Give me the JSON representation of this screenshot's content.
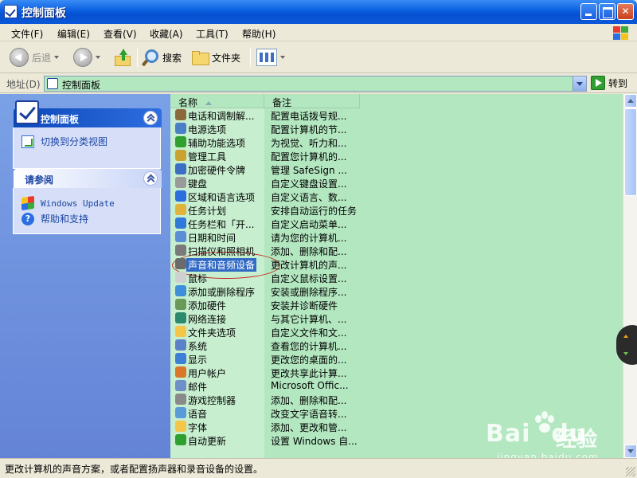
{
  "window": {
    "title": "控制面板"
  },
  "menu": [
    "文件(F)",
    "编辑(E)",
    "查看(V)",
    "收藏(A)",
    "工具(T)",
    "帮助(H)"
  ],
  "toolbar": {
    "back": "后退",
    "search": "搜索",
    "folders": "文件夹"
  },
  "address": {
    "label": "地址(D)",
    "value": "控制面板",
    "go": "转到"
  },
  "left_panel": {
    "main": {
      "title": "控制面板",
      "task": "切换到分类视图"
    },
    "see_also": {
      "title": "请参阅",
      "links": [
        "Windows Update",
        "帮助和支持"
      ]
    }
  },
  "list": {
    "columns": [
      "名称",
      "备注"
    ],
    "selected_index": 11,
    "items": [
      {
        "name": "电话和调制解...",
        "note": "配置电话拨号规...",
        "icon_color": "#8a6a3c"
      },
      {
        "name": "电源选项",
        "note": "配置计算机的节...",
        "icon_color": "#4a7fc7"
      },
      {
        "name": "辅助功能选项",
        "note": "为视觉、听力和...",
        "icon_color": "#2fa02f"
      },
      {
        "name": "管理工具",
        "note": "配置您计算机的...",
        "icon_color": "#c9a232"
      },
      {
        "name": "加密硬件令牌",
        "note": "管理 SafeSign ...",
        "icon_color": "#3c6fc4"
      },
      {
        "name": "键盘",
        "note": "自定义键盘设置...",
        "icon_color": "#9a9a9a"
      },
      {
        "name": "区域和语言选项",
        "note": "自定义语言、数...",
        "icon_color": "#2b6ee0"
      },
      {
        "name": "任务计划",
        "note": "安排自动运行的任务",
        "icon_color": "#e0b43a"
      },
      {
        "name": "任务栏和「开...",
        "note": "自定义启动菜单...",
        "icon_color": "#2f7ad8"
      },
      {
        "name": "日期和时间",
        "note": "请为您的计算机...",
        "icon_color": "#5a8fd8"
      },
      {
        "name": "扫描仪和照相机",
        "note": "添加、删除和配...",
        "icon_color": "#7a7a7a"
      },
      {
        "name": "声音和音频设备",
        "note": "更改计算机的声...",
        "icon_color": "#6b6b6b"
      },
      {
        "name": "鼠标",
        "note": "自定义鼠标设置...",
        "icon_color": "#d0d0d0"
      },
      {
        "name": "添加或删除程序",
        "note": "安装或删除程序...",
        "icon_color": "#3c8fd8"
      },
      {
        "name": "添加硬件",
        "note": "安装并诊断硬件",
        "icon_color": "#6a9a5a"
      },
      {
        "name": "网络连接",
        "note": "与其它计算机、...",
        "icon_color": "#2b8a6e"
      },
      {
        "name": "文件夹选项",
        "note": "自定义文件和文...",
        "icon_color": "#f3c64a"
      },
      {
        "name": "系统",
        "note": "查看您的计算机...",
        "icon_color": "#5b82c9"
      },
      {
        "name": "显示",
        "note": "更改您的桌面的...",
        "icon_color": "#3d7fd6"
      },
      {
        "name": "用户帐户",
        "note": "更改共享此计算...",
        "icon_color": "#d9762a"
      },
      {
        "name": "邮件",
        "note": "Microsoft Offic...",
        "icon_color": "#6f8fc7"
      },
      {
        "name": "游戏控制器",
        "note": "添加、删除和配...",
        "icon_color": "#8a8a8a"
      },
      {
        "name": "语音",
        "note": "改变文字语音转...",
        "icon_color": "#5a9ad8"
      },
      {
        "name": "字体",
        "note": "添加、更改和管...",
        "icon_color": "#f3c64a"
      },
      {
        "name": "自动更新",
        "note": "设置 Windows 自...",
        "icon_color": "#2fa02f"
      }
    ]
  },
  "status": {
    "text": "更改计算机的声音方案，或者配置扬声器和录音设备的设置。"
  },
  "watermark": {
    "brand": "Bai",
    "brand2": "du",
    "cn": "经验",
    "url": "jingyan.baidu.com"
  }
}
